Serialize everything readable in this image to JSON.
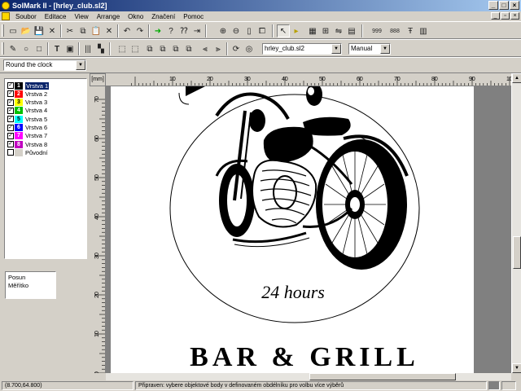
{
  "window": {
    "title": "SolMark II - [hrley_club.sl2]"
  },
  "menu": [
    "Soubor",
    "Editace",
    "View",
    "Arrange",
    "Okno",
    "Značení",
    "Pomoc"
  ],
  "toolbar": {
    "file_combo": "hrley_club.sl2",
    "mode_combo": "Manual",
    "text_combo": "Round the clock",
    "t999": "999",
    "t888": "888"
  },
  "layers": [
    {
      "label": "Vrstva 1",
      "num": "1",
      "color": "#000000",
      "checked": true
    },
    {
      "label": "Vrstva 2",
      "num": "2",
      "color": "#ff0000",
      "checked": true
    },
    {
      "label": "Vrstva 3",
      "num": "3",
      "color": "#ffff00",
      "checked": true
    },
    {
      "label": "Vrstva 4",
      "num": "4",
      "color": "#00c000",
      "checked": true
    },
    {
      "label": "Vrstva 5",
      "num": "5",
      "color": "#00ffff",
      "checked": true
    },
    {
      "label": "Vrstva 6",
      "num": "6",
      "color": "#0000ff",
      "checked": true
    },
    {
      "label": "Vrstva 7",
      "num": "7",
      "color": "#ff00ff",
      "checked": true
    },
    {
      "label": "Vrstva 8",
      "num": "8",
      "color": "#c000c0",
      "checked": true
    },
    {
      "label": "Původní",
      "num": "",
      "color": "#d4d0c8",
      "checked": false
    }
  ],
  "info": {
    "line1": "Posun",
    "line2": "Měřítko"
  },
  "ruler": {
    "unit": "[mm]",
    "h_labels": [
      "10",
      "20",
      "30",
      "40",
      "50",
      "60",
      "70",
      "80",
      "90",
      "100",
      "110"
    ],
    "v_labels": [
      "70",
      "60",
      "50",
      "40",
      "30",
      "20",
      "10",
      "0"
    ]
  },
  "drawing": {
    "caption": "24 hours",
    "headline": "BAR & GRILL"
  },
  "status": {
    "coords": "(8.700,64.800)",
    "message": "Připraven: vybere objektové body v definovaném obdélníku pro volbu více výběrů"
  }
}
